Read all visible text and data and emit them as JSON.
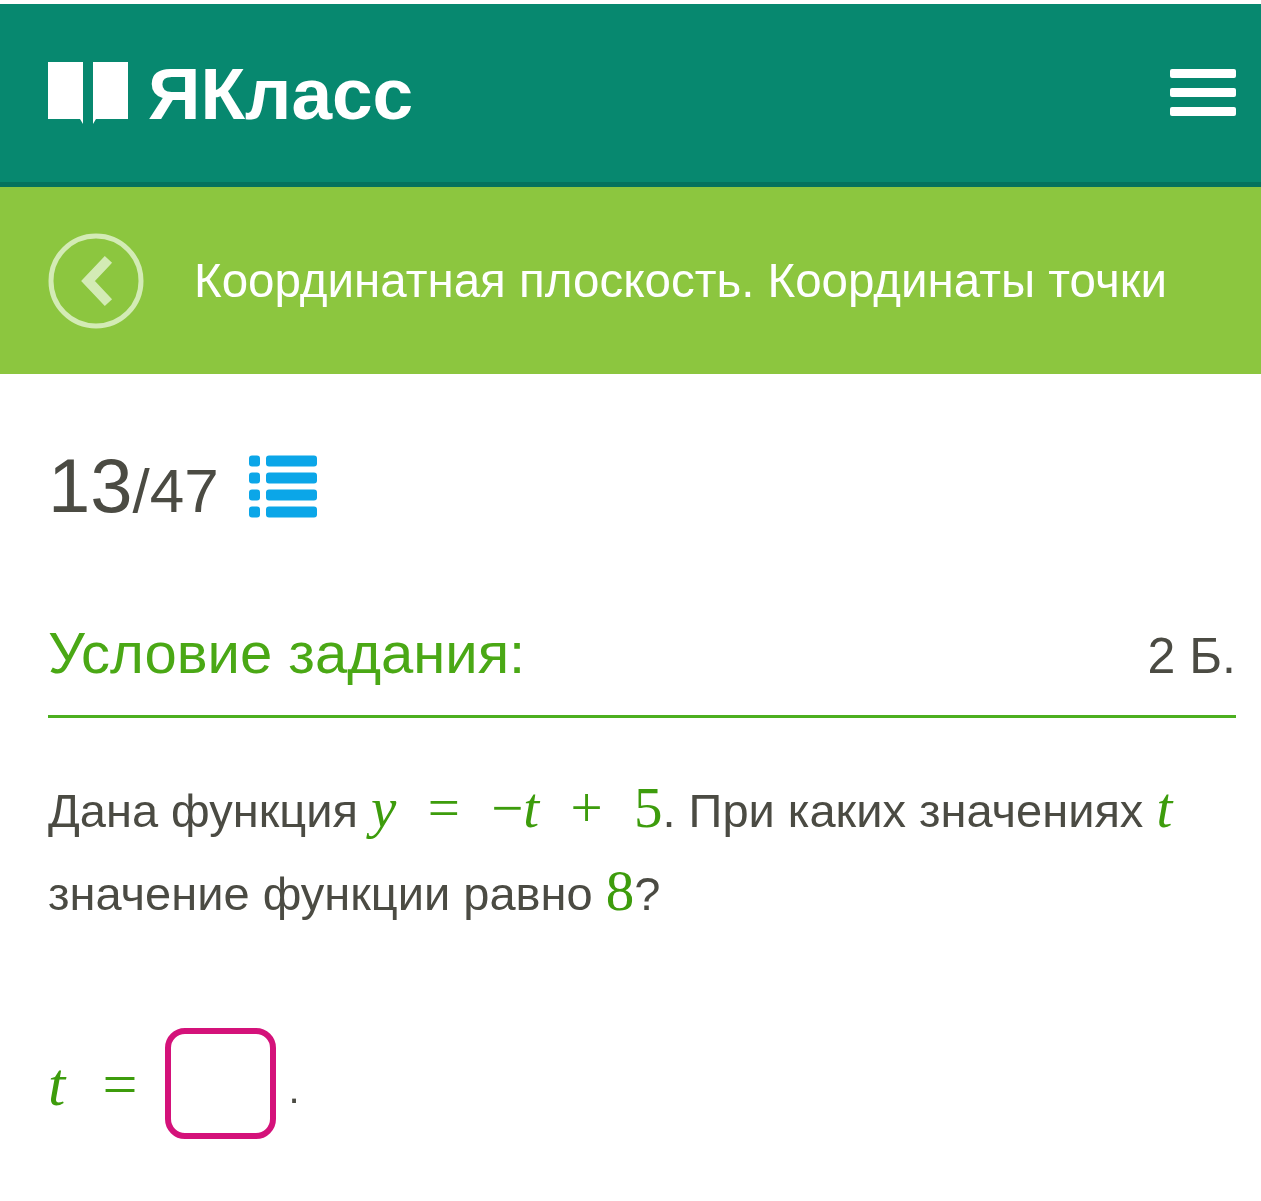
{
  "header": {
    "logo_text": "ЯКласс"
  },
  "topic_bar": {
    "title": "Координатная плоскость. Координаты точки"
  },
  "progress": {
    "current": "13",
    "of_total": "/47"
  },
  "task": {
    "heading": "Условие задания:",
    "points": "2 Б.",
    "question": [
      {
        "kind": "text",
        "text": "Дана функция "
      },
      {
        "kind": "math",
        "text": "*y* = −*t* + 5"
      },
      {
        "kind": "text",
        "text": ". При каких значениях "
      },
      {
        "kind": "math",
        "text": "*t*"
      },
      {
        "kind": "text",
        "text": " значение функции равно "
      },
      {
        "kind": "math",
        "text": "8"
      },
      {
        "kind": "text",
        "text": "?"
      }
    ],
    "answer": {
      "lhs": "*t* =",
      "suffix": "."
    }
  }
}
